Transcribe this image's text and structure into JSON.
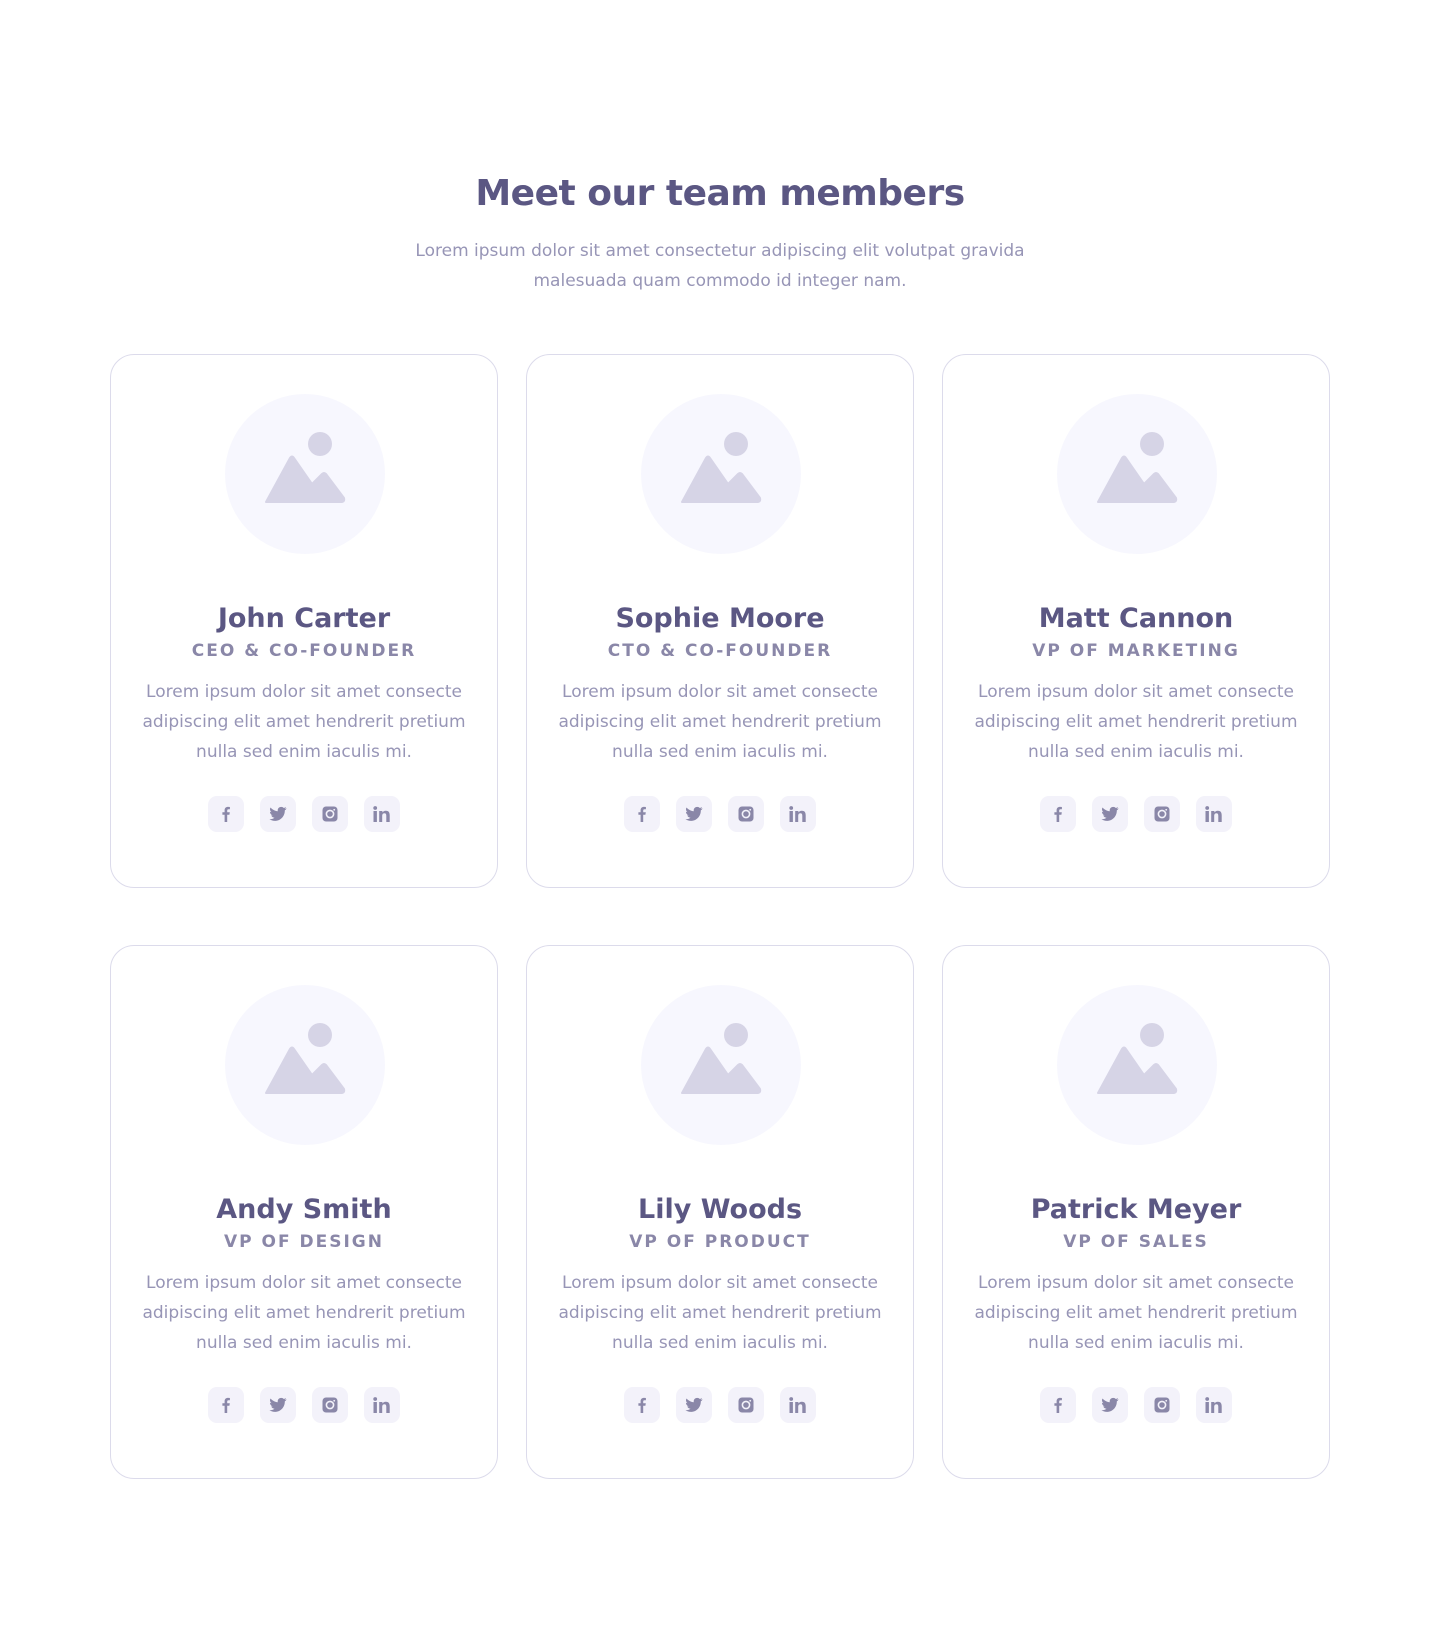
{
  "header": {
    "title": "Meet our team members",
    "subtitle": "Lorem ipsum dolor sit amet consectetur adipiscing elit volutpat gravida malesuada quam commodo id integer nam."
  },
  "colors": {
    "heading": "#5b5783",
    "body_text": "#9795b6",
    "card_border": "#dcdbeb",
    "avatar_bg": "#f7f7fe",
    "placeholder_icon": "#d6d4e6",
    "social_bg": "#f3f2fa",
    "social_icon": "#8a87a8"
  },
  "social_icons": [
    "facebook-icon",
    "twitter-icon",
    "instagram-icon",
    "linkedin-icon"
  ],
  "members": [
    {
      "name": "John Carter",
      "role": "CEO & CO-FOUNDER",
      "bio": "Lorem ipsum dolor sit amet consecte adipiscing elit amet hendrerit pretium nulla sed enim iaculis mi."
    },
    {
      "name": "Sophie Moore",
      "role": "CTO & CO-FOUNDER",
      "bio": "Lorem ipsum dolor sit amet consecte adipiscing elit amet hendrerit pretium nulla sed enim iaculis mi."
    },
    {
      "name": "Matt Cannon",
      "role": "VP OF MARKETING",
      "bio": "Lorem ipsum dolor sit amet consecte adipiscing elit amet hendrerit pretium nulla sed enim iaculis mi."
    },
    {
      "name": "Andy Smith",
      "role": "VP OF DESIGN",
      "bio": "Lorem ipsum dolor sit amet consecte adipiscing elit amet hendrerit pretium nulla sed enim iaculis mi."
    },
    {
      "name": "Lily Woods",
      "role": "VP OF PRODUCT",
      "bio": "Lorem ipsum dolor sit amet consecte adipiscing elit amet hendrerit pretium nulla sed enim iaculis mi."
    },
    {
      "name": "Patrick Meyer",
      "role": "VP OF SALES",
      "bio": "Lorem ipsum dolor sit amet consecte adipiscing elit amet hendrerit pretium nulla sed enim iaculis mi."
    }
  ]
}
